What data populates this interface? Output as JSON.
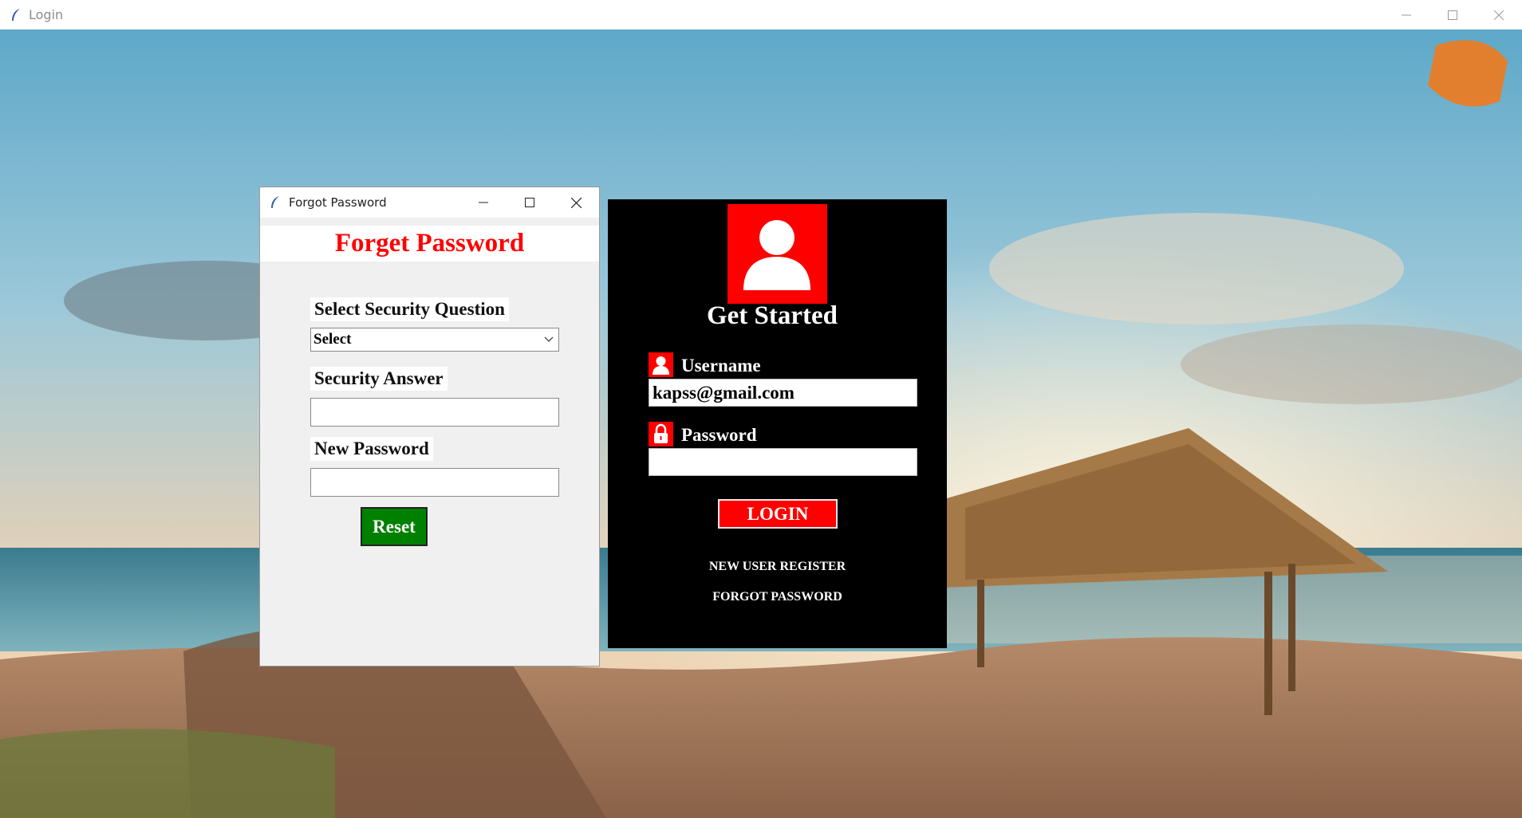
{
  "main_window": {
    "title": "Login",
    "controls": {
      "minimize": "minimize-icon",
      "maximize": "maximize-icon",
      "close": "close-icon"
    }
  },
  "forgot_window": {
    "title": "Forgot Password",
    "header": "Forget Password",
    "question_label": "Select Security Question",
    "question_selected": "Select",
    "answer_label": "Security Answer",
    "answer_value": "",
    "new_password_label": "New Password",
    "new_password_value": "",
    "reset_label": "Reset"
  },
  "login_panel": {
    "title": "Get Started",
    "username_label": "Username",
    "username_value": "kapss@gmail.com",
    "password_label": "Password",
    "password_value": "",
    "login_label": "LOGIN",
    "register_link": "NEW USER REGISTER",
    "forgot_link": "FORGOT PASSWORD"
  },
  "colors": {
    "accent_red": "#ff0000",
    "reset_green": "#008000",
    "panel_black": "#000000"
  }
}
